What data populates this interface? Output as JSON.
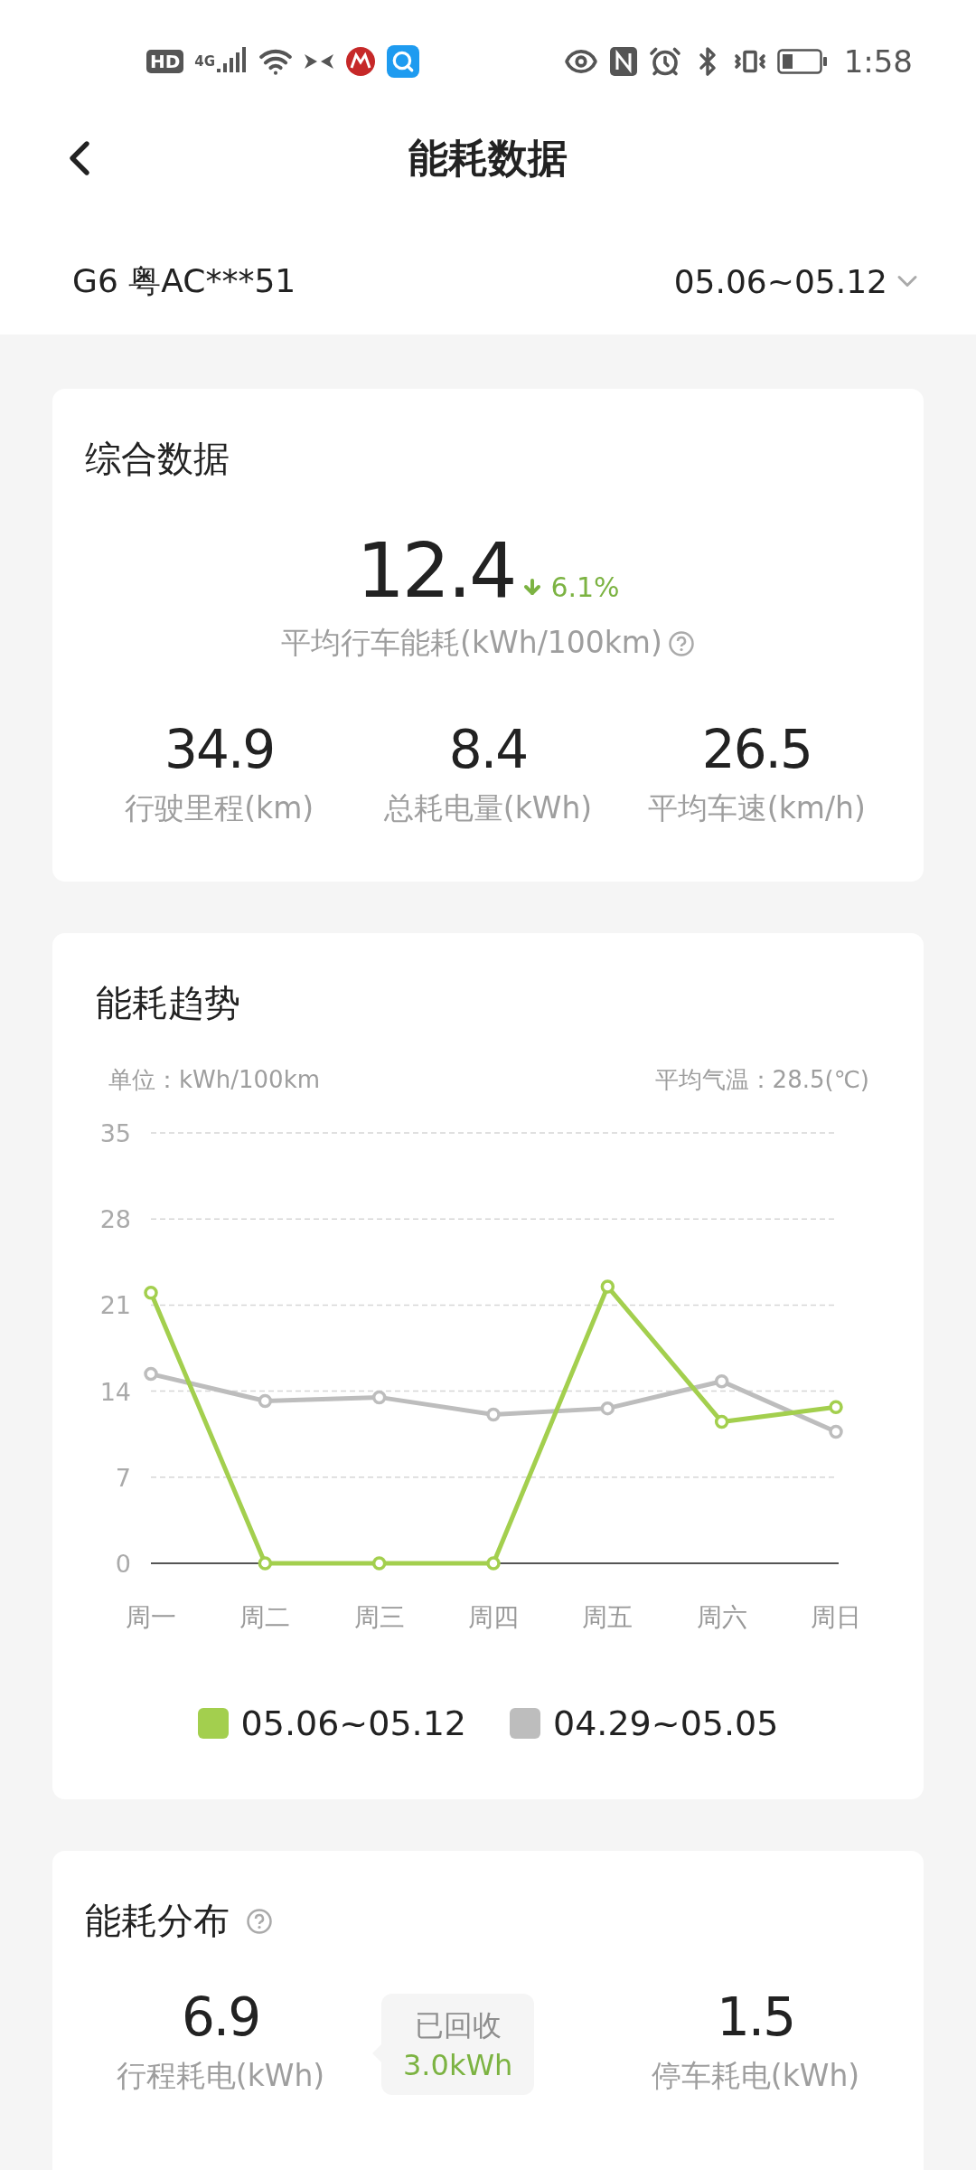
{
  "status_bar": {
    "hd_badge": "HD",
    "network": "4G",
    "time": "1:58"
  },
  "header": {
    "title": "能耗数据"
  },
  "vehicle": {
    "name": "G6 粤AC***51",
    "date_range": "05.06~05.12"
  },
  "summary": {
    "title": "综合数据",
    "main_value": "12.4",
    "change": "6.1%",
    "main_label": "平均行车能耗(kWh/100km)",
    "stats": [
      {
        "value": "34.9",
        "label": "行驶里程(km)"
      },
      {
        "value": "8.4",
        "label": "总耗电量(kWh)"
      },
      {
        "value": "26.5",
        "label": "平均车速(km/h)"
      }
    ]
  },
  "trend": {
    "title": "能耗趋势",
    "unit": "单位：kWh/100km",
    "temperature": "平均气温：28.5(℃)",
    "chart_data": {
      "type": "line",
      "categories": [
        "周一",
        "周二",
        "周三",
        "周四",
        "周五",
        "周六",
        "周日"
      ],
      "ylim": [
        0,
        35
      ],
      "yticks": [
        0,
        7,
        14,
        21,
        28,
        35
      ],
      "grid": true,
      "series": [
        {
          "name": "05.06~05.12",
          "color": "#a3cf4e",
          "marker": true,
          "values": [
            22,
            0,
            0,
            0,
            22.5,
            11.5,
            12.7
          ]
        },
        {
          "name": "04.29~05.05",
          "color": "#bdbdbd",
          "marker": true,
          "values": [
            15.4,
            13.2,
            13.5,
            12.1,
            12.6,
            14.8,
            10.7
          ]
        }
      ]
    }
  },
  "distribution": {
    "title": "能耗分布",
    "trip": {
      "value": "6.9",
      "label": "行程耗电(kWh)"
    },
    "recovered": {
      "label": "已回收",
      "value": "3.0kWh"
    },
    "parking": {
      "value": "1.5",
      "label": "停车耗电(kWh)"
    }
  }
}
